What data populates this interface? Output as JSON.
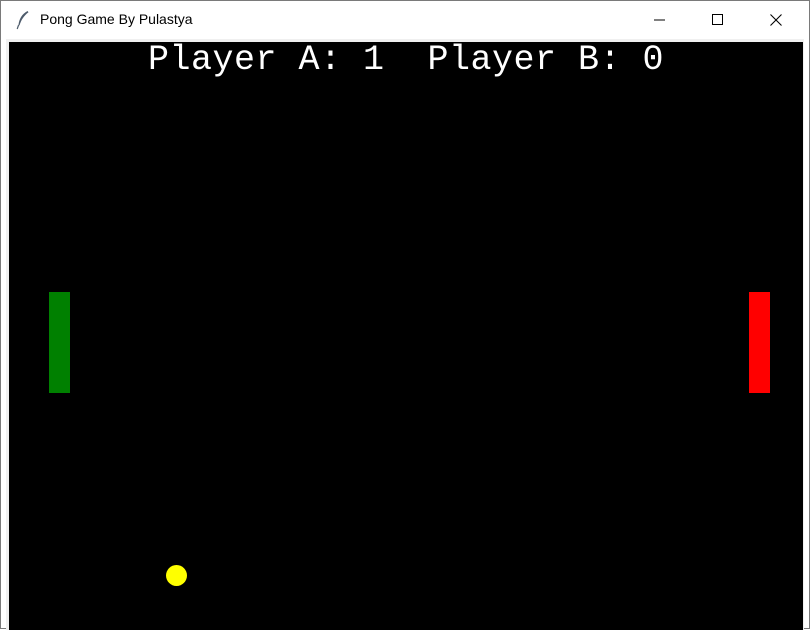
{
  "window": {
    "title": "Pong Game By Pulastya",
    "app_icon": "feather-icon",
    "controls": [
      "minimize-icon",
      "maximize-icon",
      "close-icon"
    ]
  },
  "game": {
    "score_text": "Player A: 1  Player B: 0",
    "player_a": {
      "label": "Player A",
      "score": 1
    },
    "player_b": {
      "label": "Player B",
      "score": 0
    },
    "background_color": "#000000",
    "text_color": "#ffffff",
    "paddle_a_color": "#008000",
    "paddle_b_color": "#ff0000",
    "ball_color": "#ffff00"
  }
}
